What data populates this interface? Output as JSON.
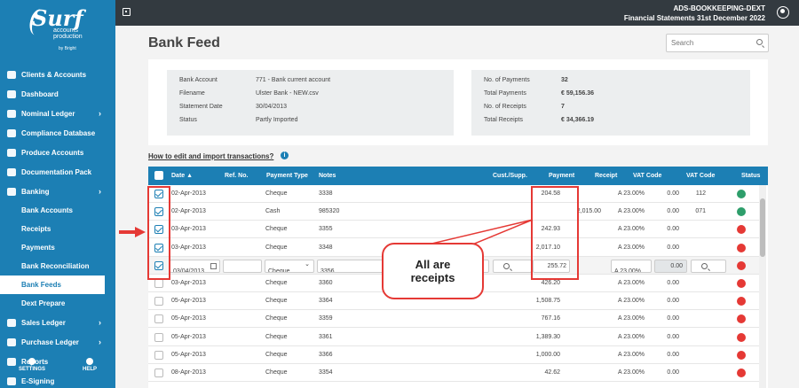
{
  "brand": {
    "name": "Surf",
    "sub_line1": "accounts",
    "sub_line2": "production",
    "by": "by Bright"
  },
  "topbar": {
    "client": "ADS-BOOKKEEPING-DEXT",
    "period": "Financial Statements 31st December 2022"
  },
  "sidebar": {
    "items": [
      {
        "label": "Clients & Accounts",
        "chevron": false
      },
      {
        "label": "Dashboard",
        "chevron": false
      },
      {
        "label": "Nominal Ledger",
        "chevron": true
      },
      {
        "label": "Compliance Database",
        "chevron": false
      },
      {
        "label": "Produce Accounts",
        "chevron": false
      },
      {
        "label": "Documentation Pack",
        "chevron": false
      },
      {
        "label": "Banking",
        "chevron": true
      }
    ],
    "banking_sub": [
      {
        "label": "Bank Accounts"
      },
      {
        "label": "Receipts"
      },
      {
        "label": "Payments"
      },
      {
        "label": "Bank Reconciliation"
      },
      {
        "label": "Bank Feeds",
        "active": true
      },
      {
        "label": "Dext Prepare"
      }
    ],
    "items_after": [
      {
        "label": "Sales Ledger",
        "chevron": true
      },
      {
        "label": "Purchase Ledger",
        "chevron": true
      },
      {
        "label": "Reports",
        "chevron": false
      },
      {
        "label": "E-Signing",
        "chevron": false
      }
    ],
    "footer": {
      "settings": "SETTINGS",
      "help": "HELP"
    }
  },
  "page": {
    "title": "Bank Feed",
    "search_placeholder": "Search"
  },
  "summary_left": [
    {
      "key": "Bank Account",
      "value": "771 - Bank current account"
    },
    {
      "key": "Filename",
      "value": "Ulster Bank - NEW.csv"
    },
    {
      "key": "Statement Date",
      "value": "30/04/2013"
    },
    {
      "key": "Status",
      "value": "Partly Imported"
    }
  ],
  "summary_right": [
    {
      "key": "No. of Payments",
      "value": "32"
    },
    {
      "key": "Total Payments",
      "value": "€ 59,156.36"
    },
    {
      "key": "No. of Receipts",
      "value": "7"
    },
    {
      "key": "Total Receipts",
      "value": "€ 34,366.19"
    }
  ],
  "howto": "How to edit and import transactions?",
  "table": {
    "headers": {
      "date": "Date",
      "sort": "▲",
      "ref": "Ref. No.",
      "ptype": "Payment Type",
      "notes": "Notes",
      "cust": "Cust./Supp.",
      "payment": "Payment",
      "receipt": "Receipt",
      "vat1": "VAT Code",
      "vat2": "VAT Code",
      "status": "Status"
    },
    "rows": [
      {
        "date": "02-Apr-2013",
        "type": "Cheque",
        "notes": "3338",
        "payment": "204.58",
        "receipt": "",
        "vat": "A 23.00%",
        "amt": "0.00",
        "code": "112",
        "status": "#2e9e6b",
        "checked": true
      },
      {
        "date": "02-Apr-2013",
        "type": "Cash",
        "notes": "985320",
        "payment": "",
        "receipt": "2,015.00",
        "vat": "A 23.00%",
        "amt": "0.00",
        "code": "071",
        "status": "#2e9e6b",
        "checked": true
      },
      {
        "date": "03-Apr-2013",
        "type": "Cheque",
        "notes": "3355",
        "payment": "242.93",
        "receipt": "",
        "vat": "A 23.00%",
        "amt": "0.00",
        "code": "",
        "status": "#e53935",
        "checked": true
      },
      {
        "date": "03-Apr-2013",
        "type": "Cheque",
        "notes": "3348",
        "payment": "2,017.10",
        "receipt": "",
        "vat": "A 23.00%",
        "amt": "0.00",
        "code": "",
        "status": "#e53935",
        "checked": true
      },
      {
        "date": "03-Apr-2013",
        "type": "Cheque",
        "notes": "3360",
        "payment": "426.20",
        "receipt": "",
        "vat": "A 23.00%",
        "amt": "0.00",
        "code": "",
        "status": "#e53935",
        "checked": false
      },
      {
        "date": "05-Apr-2013",
        "type": "Cheque",
        "notes": "3364",
        "payment": "1,508.75",
        "receipt": "",
        "vat": "A 23.00%",
        "amt": "0.00",
        "code": "",
        "status": "#e53935",
        "checked": false
      },
      {
        "date": "05-Apr-2013",
        "type": "Cheque",
        "notes": "3359",
        "payment": "767.16",
        "receipt": "",
        "vat": "A 23.00%",
        "amt": "0.00",
        "code": "",
        "status": "#e53935",
        "checked": false
      },
      {
        "date": "05-Apr-2013",
        "type": "Cheque",
        "notes": "3361",
        "payment": "1,389.30",
        "receipt": "",
        "vat": "A 23.00%",
        "amt": "0.00",
        "code": "",
        "status": "#e53935",
        "checked": false
      },
      {
        "date": "05-Apr-2013",
        "type": "Cheque",
        "notes": "3366",
        "payment": "1,000.00",
        "receipt": "",
        "vat": "A 23.00%",
        "amt": "0.00",
        "code": "",
        "status": "#e53935",
        "checked": false
      },
      {
        "date": "08-Apr-2013",
        "type": "Cheque",
        "notes": "3354",
        "payment": "42.62",
        "receipt": "",
        "vat": "A 23.00%",
        "amt": "0.00",
        "code": "",
        "status": "#e53935",
        "checked": false
      }
    ],
    "edit_row": {
      "date": "03/04/2013",
      "type": "Cheque",
      "notes": "3356",
      "payment": "255.72",
      "vat": "A 23.00%",
      "amt": "0.00",
      "status": "#e53935"
    }
  },
  "annotation": {
    "callout_line1": "All are",
    "callout_line2": "receipts"
  }
}
